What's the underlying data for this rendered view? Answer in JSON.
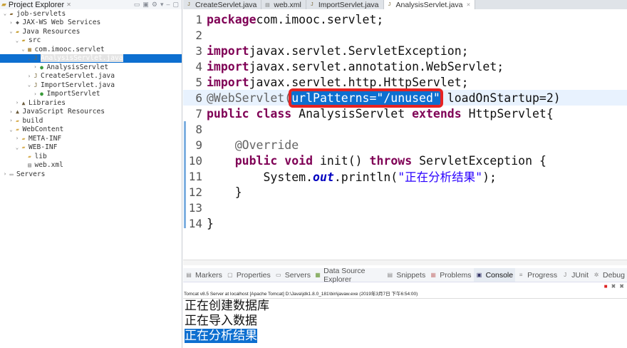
{
  "explorer": {
    "title": "Project Explorer",
    "items": [
      {
        "label": "job-servlets",
        "level": 0,
        "exp": "open",
        "icon": "project-icon"
      },
      {
        "label": "JAX-WS Web Services",
        "level": 1,
        "exp": "closed",
        "icon": "webservices-icon"
      },
      {
        "label": "Java Resources",
        "level": 1,
        "exp": "open",
        "icon": "java-resources-icon"
      },
      {
        "label": "src",
        "level": 2,
        "exp": "open",
        "icon": "source-folder-icon"
      },
      {
        "label": "com.imooc.servlet",
        "level": 3,
        "exp": "open",
        "icon": "package-icon"
      },
      {
        "label": "AnalysisServlet.java",
        "level": 4,
        "exp": "open",
        "icon": "java-file-icon",
        "selected": true
      },
      {
        "label": "AnalysisServlet",
        "level": 5,
        "exp": "closed",
        "icon": "class-icon"
      },
      {
        "label": "CreateServlet.java",
        "level": 4,
        "exp": "closed",
        "icon": "java-file-icon"
      },
      {
        "label": "ImportServlet.java",
        "level": 4,
        "exp": "open",
        "icon": "java-file-icon"
      },
      {
        "label": "ImportServlet",
        "level": 5,
        "exp": "closed",
        "icon": "class-icon"
      },
      {
        "label": "Libraries",
        "level": 2,
        "exp": "closed",
        "icon": "library-icon"
      },
      {
        "label": "JavaScript Resources",
        "level": 1,
        "exp": "closed",
        "icon": "library-icon"
      },
      {
        "label": "build",
        "level": 1,
        "exp": "closed",
        "icon": "folder-icon"
      },
      {
        "label": "WebContent",
        "level": 1,
        "exp": "open",
        "icon": "folder-icon"
      },
      {
        "label": "META-INF",
        "level": 2,
        "exp": "closed",
        "icon": "folder-icon"
      },
      {
        "label": "WEB-INF",
        "level": 2,
        "exp": "open",
        "icon": "folder-icon"
      },
      {
        "label": "lib",
        "level": 3,
        "exp": "none",
        "icon": "folder-icon"
      },
      {
        "label": "web.xml",
        "level": 3,
        "exp": "none",
        "icon": "xml-file-icon"
      },
      {
        "label": "Servers",
        "level": 0,
        "exp": "closed",
        "icon": "servers-icon"
      }
    ]
  },
  "editor": {
    "tabs": [
      {
        "label": "CreateServlet.java",
        "icon": "java-file-icon"
      },
      {
        "label": "web.xml",
        "icon": "xml-file-icon"
      },
      {
        "label": "ImportServlet.java",
        "icon": "java-file-icon"
      },
      {
        "label": "AnalysisServlet.java",
        "icon": "java-file-icon",
        "active": true
      }
    ],
    "lines": [
      {
        "n": "1",
        "t": [
          [
            "k",
            "package"
          ],
          [
            "",
            "com.imooc.servlet;"
          ]
        ]
      },
      {
        "n": "2",
        "t": []
      },
      {
        "n": "3",
        "t": [
          [
            "k",
            "import"
          ],
          [
            "",
            "javax.servlet.ServletException;"
          ]
        ]
      },
      {
        "n": "4",
        "t": [
          [
            "k",
            "import"
          ],
          [
            "",
            "javax.servlet.annotation.WebServlet;"
          ]
        ]
      },
      {
        "n": "5",
        "t": [
          [
            "k",
            "import"
          ],
          [
            "",
            "javax.servlet.http.HttpServlet;"
          ]
        ]
      },
      {
        "n": "6",
        "hl": true,
        "t": [
          [
            "a",
            "@WebServlet("
          ],
          [
            "sel box",
            "urlPatterns=\"/unused\""
          ],
          [
            "",
            " loadOnStartup=2)"
          ]
        ]
      },
      {
        "n": "7",
        "t": [
          [
            "k",
            "public"
          ],
          [
            "",
            " "
          ],
          [
            "k",
            "class"
          ],
          [
            "",
            " AnalysisServlet "
          ],
          [
            "k",
            "extends"
          ],
          [
            "",
            " HttpServlet{"
          ]
        ]
      },
      {
        "n": "8",
        "t": []
      },
      {
        "n": "9",
        "t": [
          [
            "a",
            "    @Override"
          ]
        ]
      },
      {
        "n": "10",
        "t": [
          [
            "",
            "    "
          ],
          [
            "k",
            "public"
          ],
          [
            "",
            " "
          ],
          [
            "k",
            "void"
          ],
          [
            "",
            " init() "
          ],
          [
            "k",
            "throws"
          ],
          [
            "",
            " ServletException {"
          ]
        ]
      },
      {
        "n": "11",
        "t": [
          [
            "",
            "        System."
          ],
          [
            "f",
            "out"
          ],
          [
            "",
            ".println("
          ],
          [
            "s",
            "\"正在分析结果\""
          ],
          [
            "",
            ");"
          ]
        ]
      },
      {
        "n": "12",
        "t": [
          [
            "",
            "    }"
          ]
        ]
      },
      {
        "n": "13",
        "t": []
      },
      {
        "n": "14",
        "t": [
          [
            "",
            "}"
          ]
        ]
      }
    ]
  },
  "bottom": {
    "tabs": [
      {
        "label": "Markers",
        "icon": "markers-icon"
      },
      {
        "label": "Properties",
        "icon": "properties-icon"
      },
      {
        "label": "Servers",
        "icon": "servers-icon"
      },
      {
        "label": "Data Source Explorer",
        "icon": "data-source-icon"
      },
      {
        "label": "Snippets",
        "icon": "snippets-icon"
      },
      {
        "label": "Problems",
        "icon": "problems-icon"
      },
      {
        "label": "Console",
        "icon": "console-icon",
        "active": true
      },
      {
        "label": "Progress",
        "icon": "progress-icon"
      },
      {
        "label": "JUnit",
        "icon": "junit-icon"
      },
      {
        "label": "Debug",
        "icon": "debug-icon"
      }
    ],
    "console_info": "Tomcat v8.5 Server at localhost [Apache Tomcat] D:\\Java\\jdk1.8.0_181\\bin\\javaw.exe (2019年3月7日 下午6:54:00)",
    "output": [
      "正在创建数据库",
      "正在导入数据",
      "正在分析结果"
    ],
    "colors": {
      "selection": "#0d6fd0",
      "highlight_box": "#e62222"
    }
  }
}
